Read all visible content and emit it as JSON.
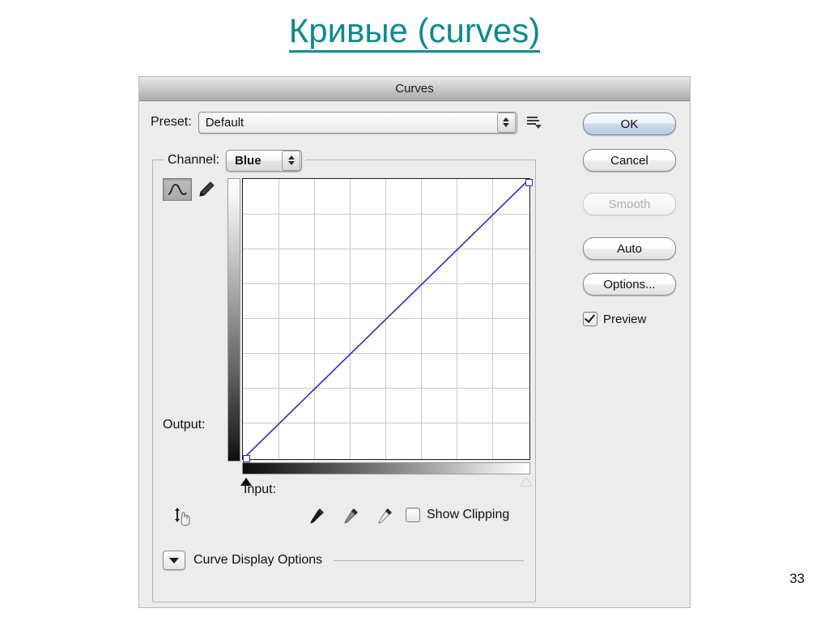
{
  "slide": {
    "title": "Кривые (curves)",
    "page_number": "33",
    "title_color": "#0f8a8f"
  },
  "dialog": {
    "title": "Curves",
    "preset": {
      "label": "Preset:",
      "value": "Default",
      "stepper_icon": "stepper-arrows-icon",
      "menu_icon": "preset-menu-icon"
    },
    "channel": {
      "label": "Channel:",
      "value": "Blue"
    },
    "tools": {
      "curve_tool_icon": "curve-edit-icon",
      "pencil_tool_icon": "pencil-icon",
      "scrubby_icon": "scrubby-slider-hand-icon",
      "eyedroppers": [
        "black-point-eyedropper-icon",
        "gray-point-eyedropper-icon",
        "white-point-eyedropper-icon"
      ]
    },
    "graph": {
      "output_label": "Output:",
      "input_label": "Input:",
      "black_point_marker": "black-point-triangle",
      "white_point_marker": "white-point-triangle"
    },
    "buttons": [
      {
        "id": "ok",
        "label": "OK",
        "state": "default"
      },
      {
        "id": "cancel",
        "label": "Cancel",
        "state": "normal"
      },
      {
        "id": "smooth",
        "label": "Smooth",
        "state": "disabled"
      },
      {
        "id": "auto",
        "label": "Auto",
        "state": "normal"
      },
      {
        "id": "options",
        "label": "Options...",
        "state": "normal"
      }
    ],
    "checkboxes": [
      {
        "id": "preview",
        "label": "Preview",
        "checked": true
      },
      {
        "id": "show-clipping",
        "label": "Show Clipping",
        "checked": false
      }
    ],
    "curve_display_options": {
      "label": "Curve Display Options",
      "expanded": false,
      "disclosure_icon": "chevron-down-icon"
    }
  },
  "chart_data": {
    "type": "line",
    "title": "Curves",
    "xlabel": "Input:",
    "ylabel": "Output:",
    "xlim": [
      0,
      255
    ],
    "ylim": [
      0,
      255
    ],
    "grid": true,
    "grid_divisions": 8,
    "legend": "none",
    "series": [
      {
        "name": "Blue",
        "color": "#2a2ad0",
        "x": [
          0,
          255
        ],
        "y": [
          0,
          255
        ],
        "control_points": [
          {
            "input": 0,
            "output": 0
          },
          {
            "input": 255,
            "output": 255
          }
        ]
      }
    ],
    "annotations": [
      "identity (linear) curve",
      "vertical grayscale ramp on left axis (white top to black bottom)",
      "horizontal grayscale ramp under x axis (black left to white right)"
    ]
  }
}
